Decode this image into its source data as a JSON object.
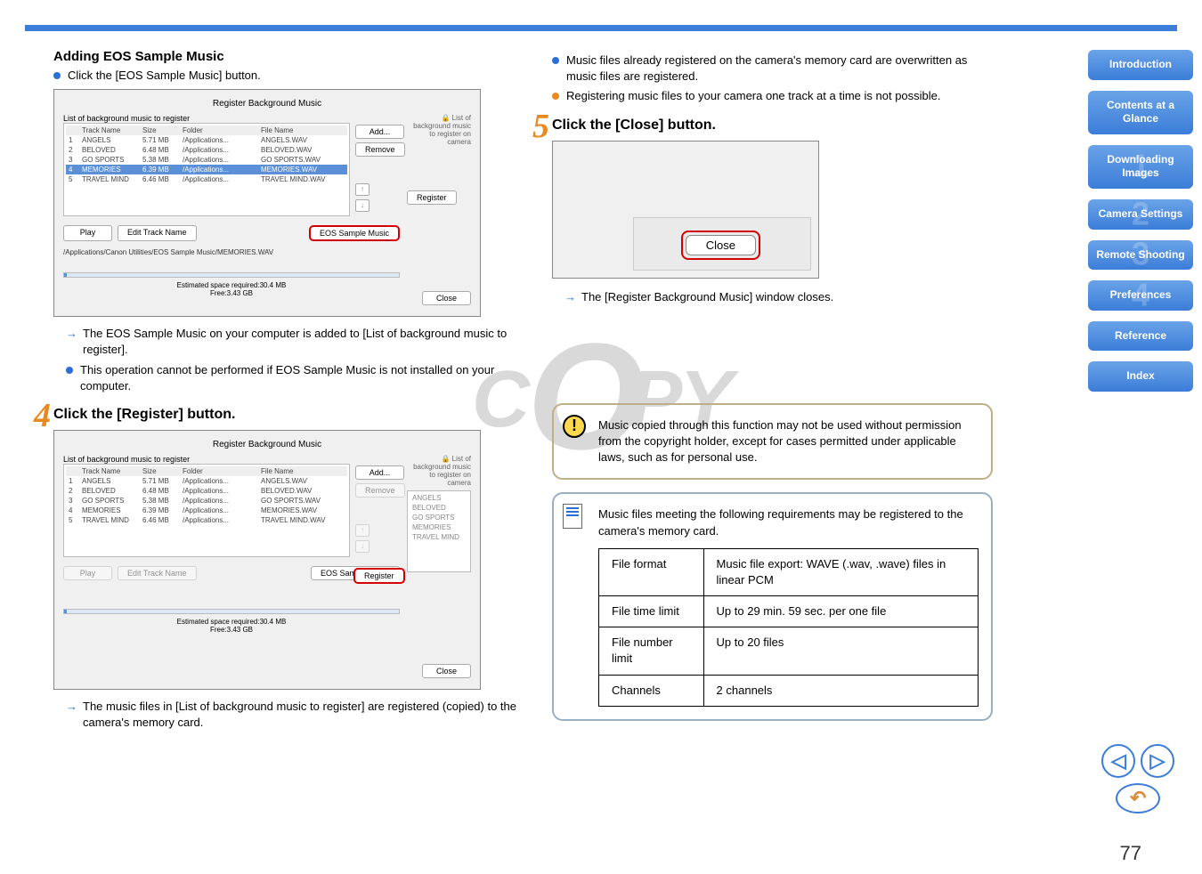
{
  "page": {
    "number": "77"
  },
  "watermark": {
    "c": "C",
    "o1": "O",
    "p": "P",
    "y": "Y"
  },
  "nav": {
    "introduction": "Introduction",
    "contents": "Contents at a Glance",
    "downloading": "Downloading Images",
    "camera": "Camera Settings",
    "remote": "Remote Shooting",
    "preferences": "Preferences",
    "reference": "Reference",
    "index": "Index"
  },
  "left": {
    "heading": "Adding EOS Sample Music",
    "sub": "Click the [EOS Sample Music] button.",
    "after1a": "The EOS Sample Music on your computer is added to [List of background music to register].",
    "after1b": "This operation cannot be performed if EOS Sample Music is not installed on your computer.",
    "step4num": "4",
    "step4": "Click the [Register] button.",
    "after4": "The music files in [List of background music to register] are registered (copied) to the camera's memory card."
  },
  "right": {
    "top1": "Music files already registered on the camera's memory card are overwritten as music files are registered.",
    "top2": "Registering music files to your camera one track at a time is not possible.",
    "step5num": "5",
    "step5": "Click the [Close] button.",
    "close_btn": "Close",
    "after5": "The [Register Background Music] window closes.",
    "warn": "Music copied through this function may not be used without permission from the copyright holder, except for cases permitted under applicable laws, such as for personal use.",
    "note": "Music files meeting the following requirements may be registered to the camera's memory card.",
    "table": {
      "r1a": "File format",
      "r1b": "Music file export: WAVE (.wav, .wave) files in linear PCM",
      "r2a": "File time limit",
      "r2b": "Up to 29 min. 59 sec. per one file",
      "r3a": "File number limit",
      "r3b": "Up to 20 files",
      "r4a": "Channels",
      "r4b": "2 channels"
    }
  },
  "dialog": {
    "title": "Register Background Music",
    "list_label": "List of background music to register",
    "camera_label": "List of background music to register on camera",
    "headers": {
      "track": "Track Name",
      "size": "Size",
      "folder": "Folder",
      "file": "File Name"
    },
    "rows": [
      {
        "n": "1",
        "track": "ANGELS",
        "size": "5.71 MB",
        "folder": "/Applications...",
        "file": "ANGELS.WAV"
      },
      {
        "n": "2",
        "track": "BELOVED",
        "size": "6.48 MB",
        "folder": "/Applications...",
        "file": "BELOVED.WAV"
      },
      {
        "n": "3",
        "track": "GO SPORTS",
        "size": "5.38 MB",
        "folder": "/Applications...",
        "file": "GO SPORTS.WAV"
      },
      {
        "n": "4",
        "track": "MEMORIES",
        "size": "6.39 MB",
        "folder": "/Applications...",
        "file": "MEMORIES.WAV"
      },
      {
        "n": "5",
        "track": "TRAVEL MIND",
        "size": "6.46 MB",
        "folder": "/Applications...",
        "file": "TRAVEL MIND.WAV"
      }
    ],
    "buttons": {
      "add": "Add...",
      "remove": "Remove",
      "register": "Register",
      "play": "Play",
      "edit": "Edit Track Name",
      "eos": "EOS Sample Music",
      "close": "Close"
    },
    "path": "/Applications/Canon Utilities/EOS Sample Music/MEMORIES.WAV",
    "space": "Estimated space required:30.4 MB",
    "free": "Free:3.43 GB",
    "camera_items": [
      "ANGELS",
      "BELOVED",
      "GO SPORTS",
      "MEMORIES",
      "TRAVEL MIND"
    ]
  }
}
